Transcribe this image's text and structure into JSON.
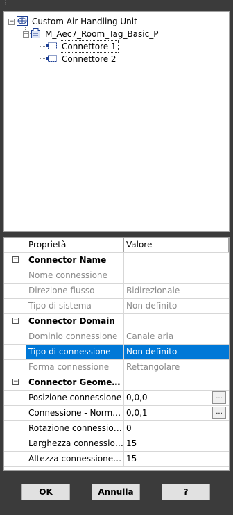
{
  "tree": {
    "root": {
      "label": "Custom Air Handling Unit",
      "icon": "family-icon"
    },
    "tag": {
      "label": "M_Aec7_Room_Tag_Basic_P",
      "icon": "tag-icon"
    },
    "connectors": [
      {
        "label": "Connettore 1",
        "icon": "connector-icon"
      },
      {
        "label": "Connettore 2",
        "icon": "connector-icon"
      }
    ]
  },
  "grid": {
    "col_property": "Proprietà",
    "col_value": "Valore",
    "sections": [
      {
        "name": "Connector Name",
        "rows": [
          {
            "prop": "Nome connessione",
            "value": ""
          }
        ]
      },
      {
        "name": "",
        "rows": [
          {
            "prop": "Direzione flusso",
            "value": "Bidirezionale"
          },
          {
            "prop": "Tipo di sistema",
            "value": "Non definito"
          }
        ]
      },
      {
        "name": "Connector Domain",
        "rows": [
          {
            "prop": "Dominio connessione",
            "value": "Canale aria"
          },
          {
            "prop": "Tipo di connessione",
            "value": "Non definito"
          },
          {
            "prop": "Forma connessione",
            "value": "Rettangolare"
          }
        ]
      },
      {
        "name": "Connector Geometry",
        "rows": [
          {
            "prop": "Posizione connessione",
            "value": "0,0,0"
          },
          {
            "prop": "Connessione - Normale",
            "value": "0,0,1"
          },
          {
            "prop": "Rotazione connessione",
            "value": "0"
          },
          {
            "prop": "Larghezza connessione ...",
            "value": "15"
          },
          {
            "prop": "Altezza connessione ret...",
            "value": "15"
          }
        ]
      }
    ],
    "ellipsis": "..."
  },
  "buttons": {
    "ok": "OK",
    "cancel": "Annulla",
    "help": "?"
  },
  "colors": {
    "selection": "#0078d7",
    "background": "#3b3b3b"
  }
}
